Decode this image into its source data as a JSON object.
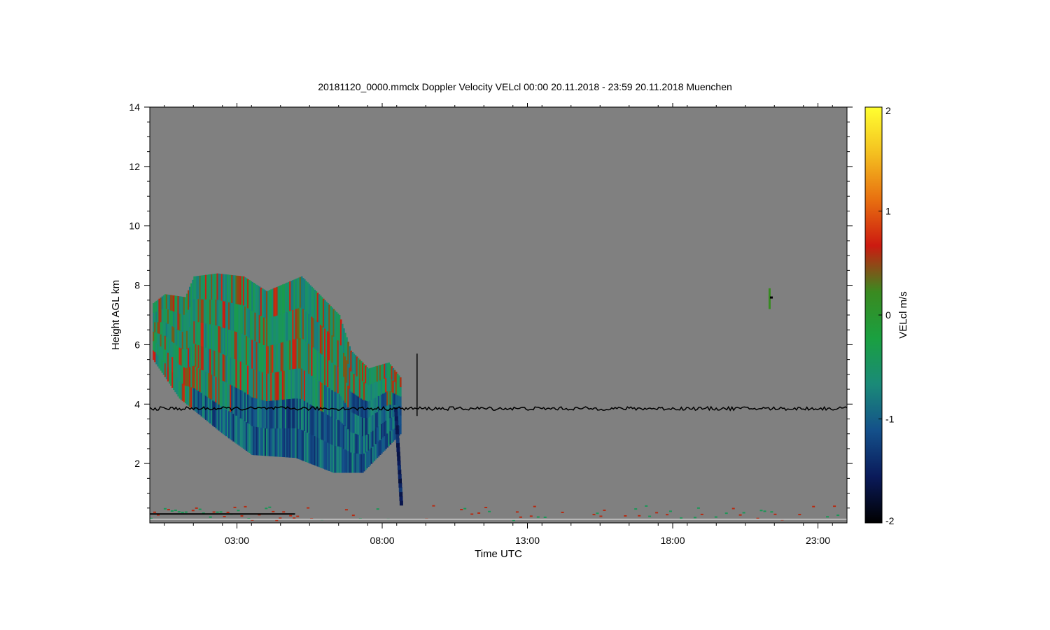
{
  "chart_data": {
    "type": "heatmap",
    "title": "20181120_0000.mmclx Doppler Velocity VELcl   00:00 20.11.2018 - 23:59 20.11.2018 Muenchen",
    "xlabel": "Time UTC",
    "ylabel": "Height AGL km",
    "xlim": [
      0,
      24
    ],
    "ylim": [
      0,
      14
    ],
    "x_unit": "hours UTC",
    "xticks": [
      {
        "value": 3,
        "label": "03:00"
      },
      {
        "value": 8,
        "label": "08:00"
      },
      {
        "value": 13,
        "label": "13:00"
      },
      {
        "value": 18,
        "label": "18:00"
      },
      {
        "value": 23,
        "label": "23:00"
      }
    ],
    "yticks": [
      {
        "value": 2,
        "label": "2"
      },
      {
        "value": 4,
        "label": "4"
      },
      {
        "value": 6,
        "label": "6"
      },
      {
        "value": 8,
        "label": "8"
      },
      {
        "value": 10,
        "label": "10"
      },
      {
        "value": 12,
        "label": "12"
      },
      {
        "value": 14,
        "label": "14"
      }
    ],
    "colorbar": {
      "label": "VELcl m/s",
      "range": [
        -2,
        2
      ],
      "ticks": [
        {
          "value": 2,
          "label": "2"
        },
        {
          "value": 1,
          "label": "1"
        },
        {
          "value": 0,
          "label": "0"
        },
        {
          "value": -1,
          "label": "-1"
        },
        {
          "value": -2,
          "label": "-2"
        }
      ],
      "colormap": [
        "#000000",
        "#0a1a5a",
        "#14508a",
        "#1a8a78",
        "#1aa040",
        "#3a8a20",
        "#cc1a10",
        "#e87010",
        "#f4c020",
        "#ffff30"
      ]
    },
    "background_color": "#808080",
    "features": [
      {
        "kind": "cloud-region",
        "time_start": 0.1,
        "time_end": 8.6,
        "height_top": 8.4,
        "height_base": 1.6,
        "dominant_velocity": -0.5
      },
      {
        "kind": "fall-streak",
        "time": 8.6,
        "height_top": 3.8,
        "height_base": 0.6,
        "velocity": -1.3
      },
      {
        "kind": "horizontal-line",
        "height": 3.85,
        "time_start": 0,
        "time_end": 24,
        "color": "#000000"
      },
      {
        "kind": "spike",
        "time": 9.2,
        "height_top": 5.7,
        "height_base": 3.6,
        "color": "#000000"
      },
      {
        "kind": "small-feature",
        "time": 21.3,
        "height": 7.6,
        "velocity": 0.2
      },
      {
        "kind": "surface-clutter",
        "time_start": 0,
        "time_end": 24,
        "height_base": 0.1,
        "height_top": 0.6
      }
    ]
  }
}
